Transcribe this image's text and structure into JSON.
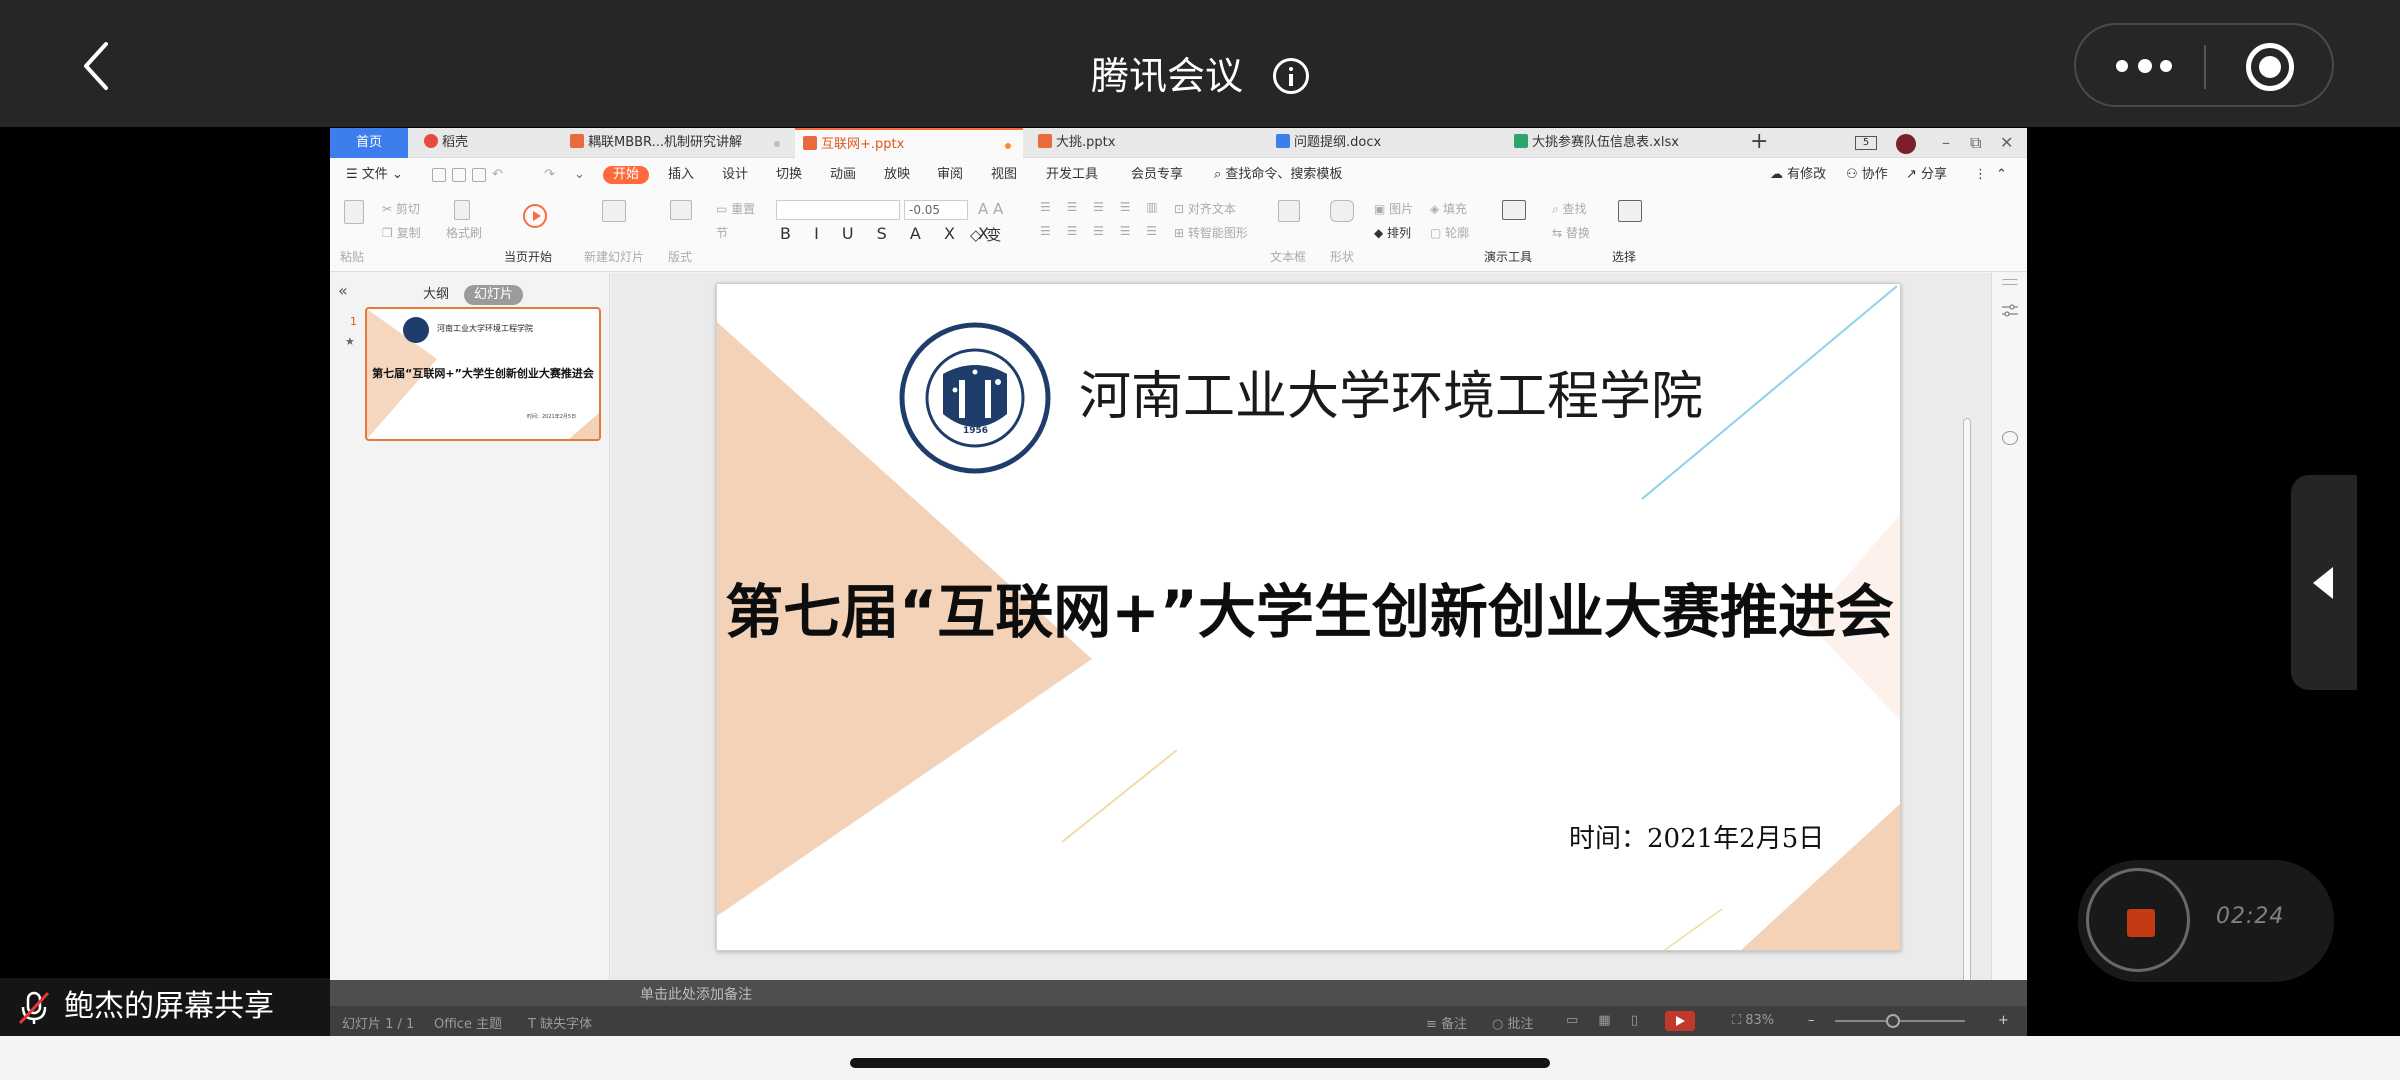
{
  "meeting": {
    "title": "腾讯会议",
    "share_label": "鲍杰的屏幕共享",
    "recording_time": "02:24"
  },
  "wps": {
    "tabs": [
      {
        "label": "首页"
      },
      {
        "label": "稻壳"
      },
      {
        "label": "耦联MBBR...机制研究讲解"
      },
      {
        "label": "互联网+.pptx"
      },
      {
        "label": "大挑.pptx"
      },
      {
        "label": "问题提纲.docx"
      },
      {
        "label": "大挑参赛队伍信息表.xlsx"
      }
    ],
    "badge": "5",
    "menu": {
      "file": "文件",
      "items": [
        "开始",
        "插入",
        "设计",
        "切换",
        "动画",
        "放映",
        "审阅",
        "视图",
        "开发工具",
        "会员专享"
      ],
      "search": "查找命令、搜索模板",
      "right": [
        "有修改",
        "协作",
        "分享"
      ]
    },
    "ribbon": {
      "paste": "粘贴",
      "cut": "剪切",
      "copy": "复制",
      "format_painter": "格式刷",
      "play_from_current": "当页开始",
      "new_slide": "新建幻灯片",
      "layout": "版式",
      "reset": "重置",
      "section": "节",
      "font_size": "-0.05",
      "align_text": "对齐文本",
      "convert_smartart": "转智能图形",
      "textbox": "文本框",
      "shape": "形状",
      "picture": "图片",
      "fill": "填充",
      "arrange": "排列",
      "outline": "轮廓",
      "presentation_tools": "演示工具",
      "find": "查找",
      "replace": "替换",
      "select": "选择"
    },
    "left_panel": {
      "tabs": [
        "大纲",
        "幻灯片"
      ],
      "slide_number": "1",
      "star": "★"
    },
    "slide": {
      "subtitle": "河南工业大学环境工程学院",
      "title": "第七届“互联网+”大学生创新创业大赛推进会",
      "date": "时间：2021年2月5日",
      "seal_year": "1956",
      "seal_ring_text": "HENAN UNIVERSITY OF TECHNOLOGY",
      "seal_top_text": "河南工業大學"
    },
    "notes_placeholder": "单击此处添加备注",
    "status": {
      "slide_count": "幻灯片 1 / 1",
      "theme": "Office 主题",
      "missing_font": "缺失字体",
      "notes": "备注",
      "comments": "批注",
      "zoom": "83%"
    }
  },
  "colors": {
    "accent_orange": "#ff6a3d",
    "wps_blue": "#3d7eed",
    "slide_peach": "#f4d2b8",
    "seal_navy": "#1f3d6b"
  }
}
